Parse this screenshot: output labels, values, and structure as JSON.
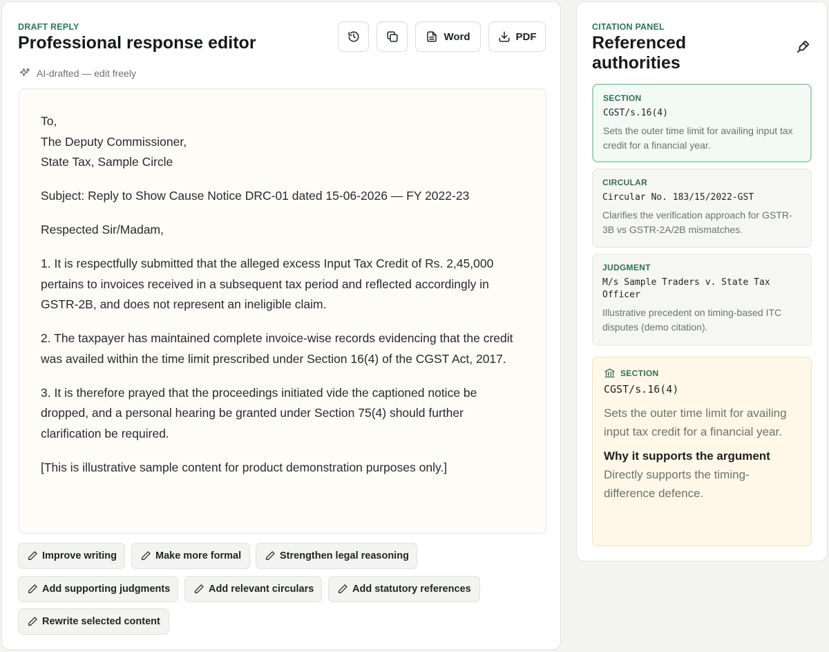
{
  "editor": {
    "eyebrow": "DRAFT REPLY",
    "title": "Professional response editor",
    "toolbar": {
      "history_icon": "history-icon",
      "copy_icon": "copy-icon",
      "word_label": "Word",
      "pdf_label": "PDF"
    },
    "ai_note": "AI-drafted — edit freely",
    "letter": {
      "to_1": "To,",
      "to_2": "The Deputy Commissioner,",
      "to_3": "State Tax, Sample Circle",
      "subject": "Subject: Reply to Show Cause Notice DRC-01 dated 15-06-2026 — FY 2022-23",
      "salutation": "Respected Sir/Madam,",
      "para_1": "1. It is respectfully submitted that the alleged excess Input Tax Credit of Rs. 2,45,000 pertains to invoices received in a subsequent tax period and reflected accordingly in GSTR-2B, and does not represent an ineligible claim.",
      "para_2": "2. The taxpayer has maintained complete invoice-wise records evidencing that the credit was availed within the time limit prescribed under Section 16(4) of the CGST Act, 2017.",
      "para_3": "3. It is therefore prayed that the proceedings initiated vide the captioned notice be dropped, and a personal hearing be granted under Section 75(4) should further clarification be required.",
      "disclaimer": "[This is illustrative sample content for product demonstration purposes only.]"
    },
    "actions": [
      "Improve writing",
      "Make more formal",
      "Strengthen legal reasoning",
      "Add supporting judgments",
      "Add relevant circulars",
      "Add statutory references",
      "Rewrite selected content"
    ]
  },
  "citations": {
    "eyebrow": "CITATION PANEL",
    "title_line1": "Referenced",
    "title_line2": "authorities",
    "items": [
      {
        "type": "SECTION",
        "ref": "CGST/s.16(4)",
        "desc": "Sets the outer time limit for availing input tax credit for a financial year."
      },
      {
        "type": "CIRCULAR",
        "ref": "Circular No. 183/15/2022-GST",
        "desc": "Clarifies the verification approach for GSTR-3B vs GSTR-2A/2B mismatches."
      },
      {
        "type": "JUDGMENT",
        "ref": "M/s Sample Traders v. State Tax Officer",
        "desc": "Illustrative precedent on timing-based ITC disputes (demo citation)."
      }
    ],
    "detail": {
      "type": "SECTION",
      "ref": "CGST/s.16(4)",
      "desc": "Sets the outer time limit for availing input tax credit for a financial year.",
      "why_label": "Why it supports the argument",
      "why_text": "Directly supports the timing-difference defence."
    }
  },
  "colors": {
    "accent": "#2c7a55",
    "active_border": "#9fd6bb",
    "detail_bg": "#fff8e8"
  }
}
